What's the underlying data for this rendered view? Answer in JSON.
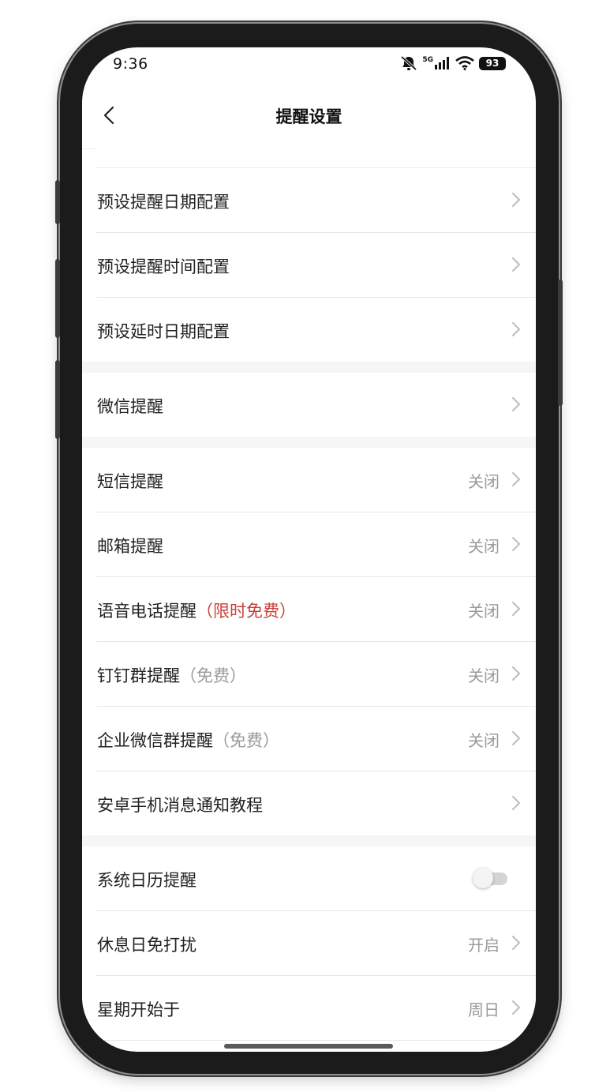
{
  "status_bar": {
    "time": "9:36",
    "network": "5G",
    "battery": "93"
  },
  "nav": {
    "title": "提醒设置"
  },
  "groups": [
    {
      "rows": [
        {
          "label": "预设提醒日期配置"
        },
        {
          "label": "预设提醒时间配置"
        },
        {
          "label": "预设延时日期配置"
        }
      ]
    },
    {
      "rows": [
        {
          "label": "微信提醒"
        }
      ]
    },
    {
      "rows": [
        {
          "label": "短信提醒",
          "value": "关闭"
        },
        {
          "label": "邮箱提醒",
          "value": "关闭"
        },
        {
          "label": "语音电话提醒",
          "note": "（限时免费）",
          "value": "关闭"
        },
        {
          "label": "钉钉群提醒",
          "note": "（免费）",
          "value": "关闭"
        },
        {
          "label": "企业微信群提醒",
          "note": "（免费）",
          "value": "关闭"
        },
        {
          "label": "安卓手机消息通知教程"
        }
      ]
    },
    {
      "rows": [
        {
          "label": "系统日历提醒",
          "toggle": "off"
        },
        {
          "label": "休息日免打扰",
          "value": "开启"
        },
        {
          "label": "星期开始于",
          "value": "周日"
        }
      ]
    }
  ],
  "colors": {
    "accent_red": "#c9403a",
    "muted_text": "#9a9a9a"
  }
}
